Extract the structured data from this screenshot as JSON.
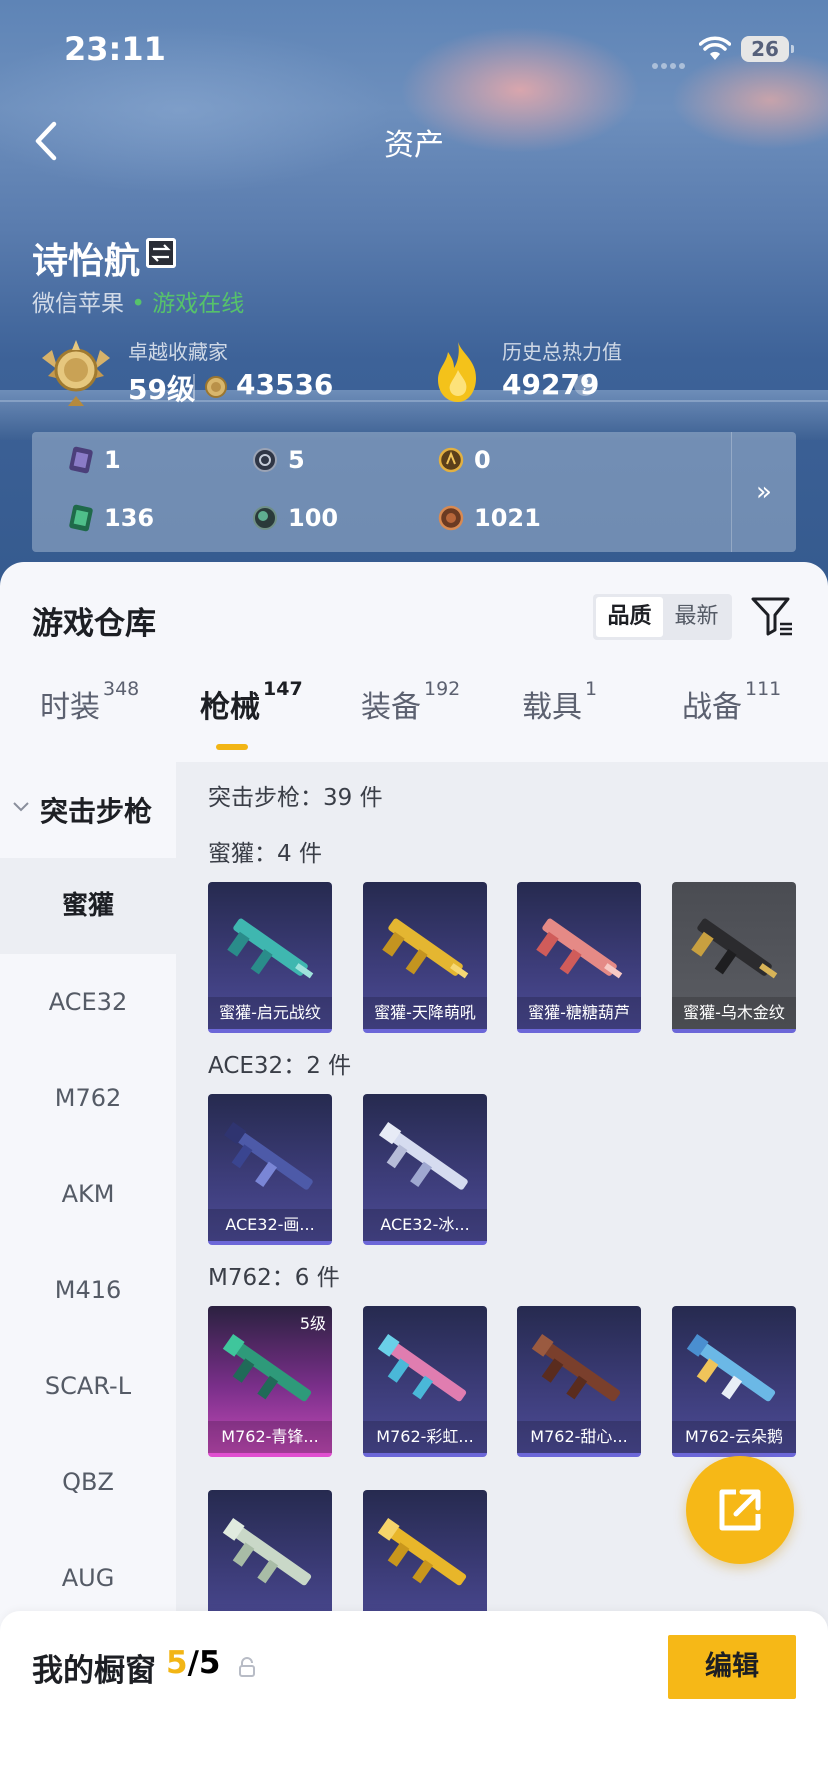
{
  "status_bar": {
    "time": "23:11",
    "battery": "26"
  },
  "nav": {
    "title": "资产"
  },
  "profile": {
    "name": "诗怡航",
    "platform": "微信苹果",
    "online_status": "• 游戏在线",
    "rank_title": "卓越收藏家",
    "rank_level": "59级",
    "rank_points": "43536",
    "heat_title": "历史总热力值",
    "heat_value": "49279",
    "help": "?"
  },
  "stats": [
    {
      "icon": "purple-card-icon",
      "value": "1"
    },
    {
      "icon": "compass-coin-icon",
      "value": "5"
    },
    {
      "icon": "gold-coin-icon",
      "value": "0"
    },
    {
      "icon": "green-card-icon",
      "value": "136"
    },
    {
      "icon": "green-gem-icon",
      "value": "100"
    },
    {
      "icon": "bronze-coin-icon",
      "value": "1021"
    }
  ],
  "stats_more": "»",
  "warehouse": {
    "title": "游戏仓库",
    "sort_options": [
      "品质",
      "最新"
    ],
    "tabs": [
      {
        "label": "时装",
        "count": "348"
      },
      {
        "label": "枪械",
        "count": "147"
      },
      {
        "label": "装备",
        "count": "192"
      },
      {
        "label": "载具",
        "count": "1"
      },
      {
        "label": "战备",
        "count": "111"
      }
    ],
    "category": "突击步枪",
    "sidebar": [
      "蜜獾",
      "ACE32",
      "M762",
      "AKM",
      "M416",
      "SCAR-L",
      "QBZ",
      "AUG"
    ],
    "summary": "突击步枪：39 件",
    "groups": [
      {
        "title": "蜜獾：4 件",
        "items": [
          "蜜獾-启元战纹",
          "蜜獾-天降萌吼",
          "蜜獾-糖糖葫芦",
          "蜜獾-乌木金纹"
        ]
      },
      {
        "title": "ACE32：2 件",
        "items": [
          "ACE32-画...",
          "ACE32-冰..."
        ]
      },
      {
        "title": "M762：6 件",
        "items": [
          "M762-青锋...",
          "M762-彩虹...",
          "M762-甜心...",
          "M762-云朵鹅"
        ],
        "badge": "5级"
      }
    ]
  },
  "showcase": {
    "label": "我的橱窗",
    "current": "5",
    "total": "/5",
    "edit": "编辑"
  },
  "colors": {
    "accent": "#f6b817",
    "online": "#56c26b",
    "card_purple": "#3c3c78",
    "card_pink": "#c24ab6"
  }
}
